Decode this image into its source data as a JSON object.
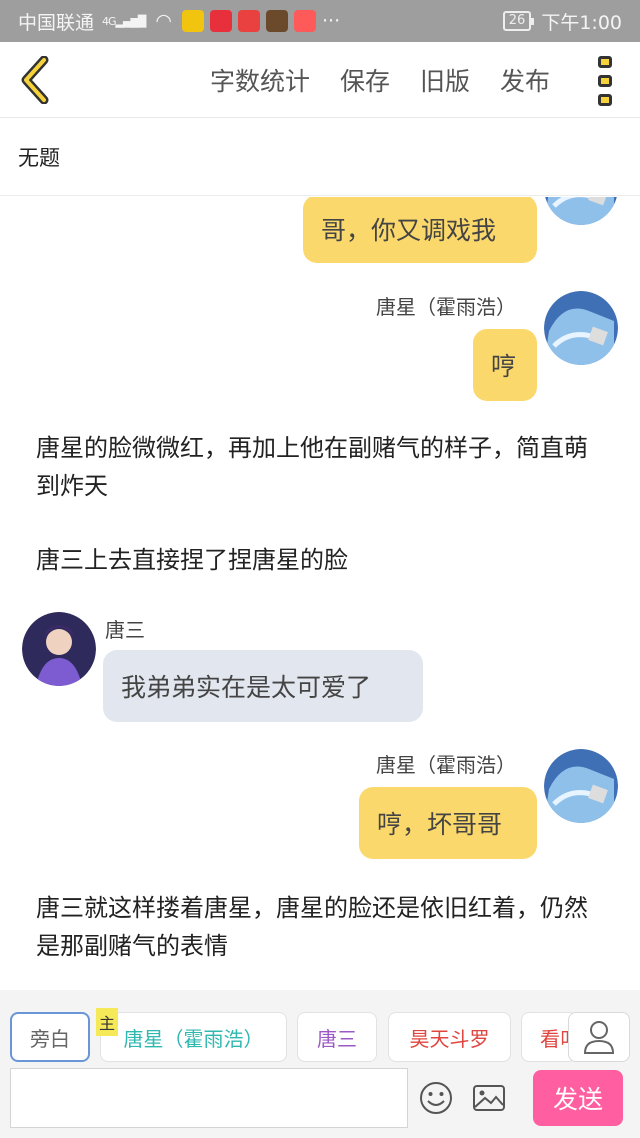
{
  "status_bar": {
    "carrier": "中国联通",
    "network": "4G",
    "battery": "26",
    "time": "下午1:00"
  },
  "toolbar": {
    "word_count": "字数统计",
    "save": "保存",
    "old_version": "旧版",
    "publish": "发布"
  },
  "document": {
    "title": "无题"
  },
  "chat": {
    "msg1": {
      "text": "哥，你又调戏我"
    },
    "msg2": {
      "speaker": "唐星（霍雨浩）",
      "text": "哼"
    },
    "narr1": "唐星的脸微微红，再加上他在副赌气的样子，简直萌到炸天",
    "narr2": "唐三上去直接捏了捏唐星的脸",
    "msg3": {
      "speaker": "唐三",
      "text": "我弟弟实在是太可爱了"
    },
    "msg4": {
      "speaker": "唐星（霍雨浩）",
      "text": "哼，坏哥哥"
    },
    "narr3": "唐三就这样搂着唐星，唐星的脸还是依旧红着，仍然是那副赌气的表情"
  },
  "roles": {
    "narrator": "旁白",
    "host_badge": "主",
    "items": [
      {
        "label": "唐星（霍雨浩）",
        "color": "#2fb8b0"
      },
      {
        "label": "唐三",
        "color": "#9b59c6"
      },
      {
        "label": "昊天斗罗",
        "color": "#e0463f"
      },
      {
        "label": "看叫",
        "color": "#e0463f"
      }
    ]
  },
  "input": {
    "placeholder": "",
    "send": "发送"
  },
  "colors": {
    "accent": "#f6d33a",
    "bubble_me": "#fbd86b",
    "bubble_other": "#e2e7ef",
    "send": "#ff5fa0"
  }
}
